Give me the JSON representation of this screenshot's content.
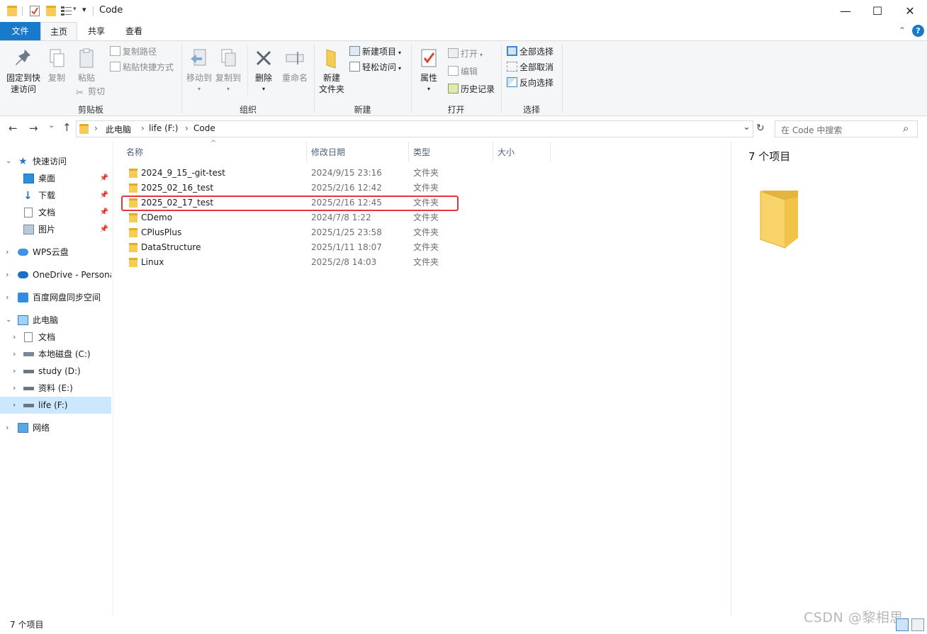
{
  "window": {
    "title": "Code",
    "minimize": "—",
    "maximize": "☐",
    "close": "✕",
    "qat_dropdown": "▾"
  },
  "tabs": {
    "file": "文件",
    "home": "主页",
    "share": "共享",
    "view": "查看",
    "collapse": "⌃",
    "help": "?"
  },
  "ribbon": {
    "clipboard": {
      "pin_line1": "固定到快",
      "pin_line2": "速访问",
      "copy": "复制",
      "paste": "粘贴",
      "copy_path": "复制路径",
      "paste_shortcut": "粘贴快捷方式",
      "cut": "剪切",
      "label": "剪贴板"
    },
    "organize": {
      "move_to": "移动到",
      "copy_to": "复制到",
      "delete": "删除",
      "rename": "重命名",
      "label": "组织"
    },
    "new": {
      "new_folder_line1": "新建",
      "new_folder_line2": "文件夹",
      "new_item": "新建项目",
      "easy_access": "轻松访问",
      "label": "新建"
    },
    "open": {
      "properties": "属性",
      "open": "打开",
      "edit": "编辑",
      "history": "历史记录",
      "label": "打开"
    },
    "select": {
      "select_all": "全部选择",
      "select_none": "全部取消",
      "invert": "反向选择",
      "label": "选择"
    }
  },
  "address": {
    "back": "←",
    "forward": "→",
    "recent": "⌄",
    "up": "↑",
    "crumbs": [
      "此电脑",
      "life (F:)",
      "Code"
    ],
    "crumb_sep": "›",
    "dropdown": "⌄",
    "refresh": "↻",
    "search_placeholder": "在 Code 中搜索",
    "search_icon": "⌕"
  },
  "nav": {
    "quick_access": "快速访问",
    "desktop": "桌面",
    "downloads": "下载",
    "documents": "文档",
    "pictures": "图片",
    "wps": "WPS云盘",
    "onedrive": "OneDrive - Persona",
    "baidu": "百度网盘同步空间",
    "this_pc": "此电脑",
    "pc_documents": "文档",
    "drive_c": "本地磁盘 (C:)",
    "drive_d": "study (D:)",
    "drive_e": "资料 (E:)",
    "drive_f": "life (F:)",
    "network": "网络"
  },
  "columns": {
    "name": "名称",
    "date": "修改日期",
    "type": "类型",
    "size": "大小",
    "sort_indicator": "^"
  },
  "files": [
    {
      "name": "2024_9_15_-git-test",
      "date": "2024/9/15 23:16",
      "type": "文件夹"
    },
    {
      "name": "2025_02_16_test",
      "date": "2025/2/16 12:42",
      "type": "文件夹"
    },
    {
      "name": "2025_02_17_test",
      "date": "2025/2/16 12:45",
      "type": "文件夹"
    },
    {
      "name": "CDemo",
      "date": "2024/7/8 1:22",
      "type": "文件夹"
    },
    {
      "name": "CPlusPlus",
      "date": "2025/1/25 23:58",
      "type": "文件夹"
    },
    {
      "name": "DataStructure",
      "date": "2025/1/11 18:07",
      "type": "文件夹"
    },
    {
      "name": "Linux",
      "date": "2025/2/8 14:03",
      "type": "文件夹"
    }
  ],
  "preview": {
    "count": "7 个项目"
  },
  "status": {
    "count": "7 个项目",
    "watermark": "CSDN @黎相思"
  },
  "colors": {
    "accent": "#1979ca",
    "selection": "#cce8ff",
    "highlight": "#e8343c",
    "folder": "#f5cc55"
  }
}
